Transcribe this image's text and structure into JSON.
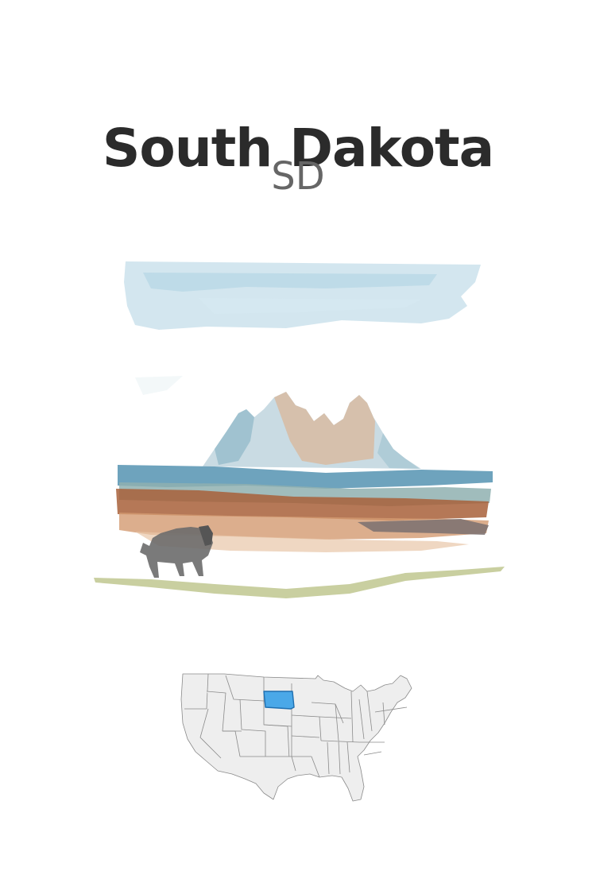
{
  "state": {
    "name": "South Dakota",
    "abbreviation": "SD"
  },
  "illustration": {
    "icon": "badlands-bison-watercolor"
  },
  "map": {
    "icon": "us-map-icon",
    "highlight_color": "#4aa8e8",
    "highlight_stroke": "#1f6fb0",
    "base_fill": "#eeeeee",
    "base_stroke": "#8a8a8a"
  }
}
